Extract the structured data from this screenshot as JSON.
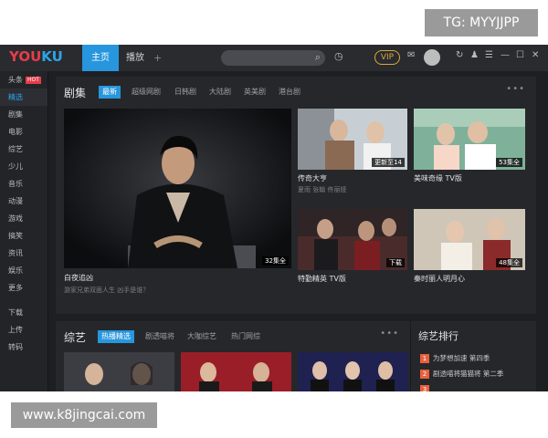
{
  "watermarks": {
    "top": "TG: MYYJJPP",
    "bottom": "www.k8jingcai.com"
  },
  "app": {
    "logo_left": "YOU",
    "logo_right": "KU",
    "nav": {
      "home": "主页",
      "play": "播放",
      "plus": "+"
    },
    "vip": "VIP"
  },
  "sidebar": {
    "items": [
      "头条",
      "精选",
      "剧集",
      "电影",
      "综艺",
      "少儿",
      "音乐",
      "动漫",
      "游戏",
      "搞笑",
      "资讯",
      "娱乐",
      "更多"
    ],
    "hot_badge": "HOT",
    "bottom_items": [
      "下载",
      "上传",
      "转码"
    ]
  },
  "drama": {
    "title": "剧集",
    "tabs": [
      "最新",
      "超级网剧",
      "日韩剧",
      "大陆剧",
      "英美剧",
      "港台剧"
    ],
    "more": "•••",
    "big": {
      "title": "白夜追凶",
      "subtitle": "游家兄弟双面人生 凶手是谁？",
      "badge": "32集全"
    },
    "cards": [
      {
        "title": "传奇大亨",
        "subtitle": "夏雨 张翰 佟丽娅",
        "badge": "更新至14"
      },
      {
        "title": "美味奇缘 TV版",
        "subtitle": "",
        "badge": "53集全"
      },
      {
        "title": "特勤精英 TV版",
        "subtitle": "",
        "badge": "下载"
      },
      {
        "title": "秦时丽人明月心",
        "subtitle": "",
        "badge": "48集全"
      }
    ]
  },
  "variety": {
    "title": "综艺",
    "tabs": [
      "热播精选",
      "剧透喵将",
      "大咖综艺",
      "热门网综"
    ],
    "more": "•••"
  },
  "ranking": {
    "title": "综艺排行",
    "items": [
      {
        "num": "1",
        "label": "为梦想加速 第四季"
      },
      {
        "num": "2",
        "label": "剧透喵将猫猫将 第二季"
      },
      {
        "num": "3",
        "label": ""
      }
    ]
  }
}
